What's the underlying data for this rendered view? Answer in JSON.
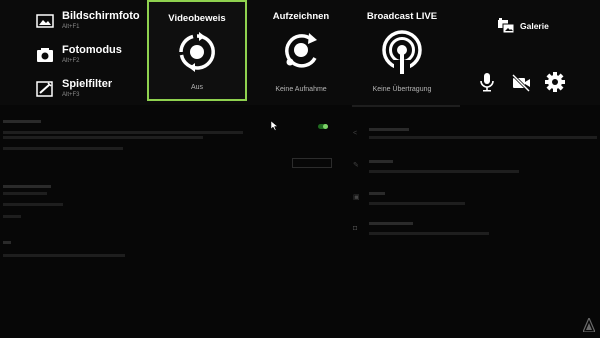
{
  "quick_actions": [
    {
      "label": "Bildschirmfoto",
      "shortcut": "Alt+F1",
      "icon": "screenshot-icon"
    },
    {
      "label": "Fotomodus",
      "shortcut": "Alt+F2",
      "icon": "camera-icon"
    },
    {
      "label": "Spielfilter",
      "shortcut": "Alt+F3",
      "icon": "filter-icon"
    }
  ],
  "tiles": [
    {
      "title": "Videobeweis",
      "status": "Aus",
      "icon": "instant-replay-icon",
      "selected": true
    },
    {
      "title": "Aufzeichnen",
      "status": "Keine Aufnahme",
      "icon": "record-icon",
      "selected": false
    },
    {
      "title": "Broadcast LIVE",
      "status": "Keine Übertragung",
      "icon": "broadcast-icon",
      "selected": false
    }
  ],
  "gallery": {
    "label": "Galerie",
    "icon": "gallery-icon"
  },
  "toolbar_icons": [
    "microphone-icon",
    "camera-off-icon",
    "settings-icon"
  ],
  "colors": {
    "accent": "#8fd14f",
    "background": "#070707",
    "overlay": "#0b0b0b"
  }
}
